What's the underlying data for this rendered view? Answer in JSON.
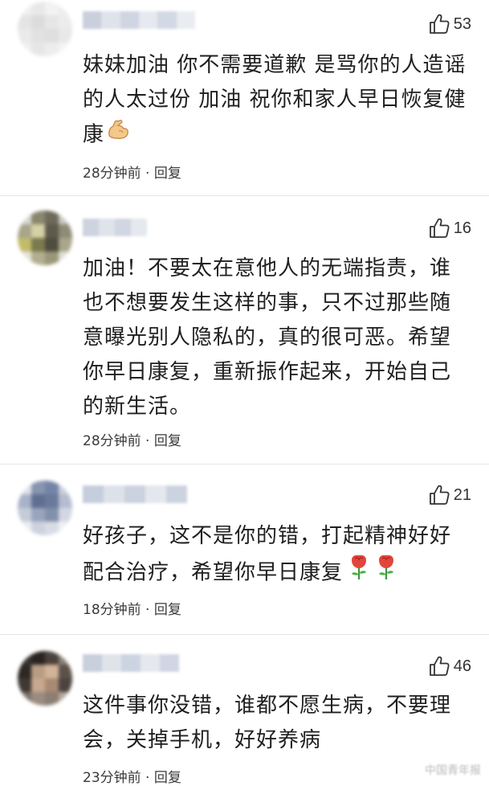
{
  "comments": [
    {
      "likes": "53",
      "text": "妹妹加油 你不需要道歉 是骂你的人造谣\n的人太过份 加油 祝你和家人早日恢复健\n康",
      "time": "28分钟前",
      "separator": "·",
      "reply": "回复",
      "emoji": "flexed-biceps-icon"
    },
    {
      "likes": "16",
      "text": "加油！不要太在意他人的无端指责，谁\n也不想要发生这样的事，只不过那些随\n意曝光别人隐私的，真的很可恶。希望\n你早日康复，重新振作起来，开始自己\n的新生活。",
      "time": "28分钟前",
      "separator": "·",
      "reply": "回复"
    },
    {
      "likes": "21",
      "text": "好孩子，这不是你的错，打起精神好好\n配合治疗，希望你早日康复",
      "time": "18分钟前",
      "separator": "·",
      "reply": "回复",
      "emoji": "rose-icon"
    },
    {
      "likes": "46",
      "text": "这件事你没错，谁都不愿生病，不要理\n会，关掉手机，好好养病",
      "time": "23分钟前",
      "separator": "·",
      "reply": "回复"
    }
  ],
  "watermark": "中国青年报",
  "colors": {
    "text": "#1f1f1f",
    "meta": "#3a3a3a",
    "rose": "#e2453c",
    "arm": "#f3c88a"
  }
}
